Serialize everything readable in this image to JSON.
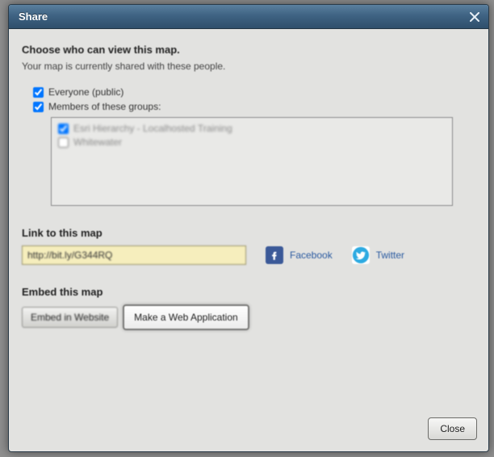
{
  "dialog": {
    "title": "Share",
    "heading": "Choose who can view this map.",
    "subtext": "Your map is currently shared with these people.",
    "everyone_label": "Everyone (public)",
    "everyone_checked": true,
    "members_label": "Members of these groups:",
    "members_checked": true,
    "groups": [
      {
        "label": "Esri Hierarchy - Localhosted Training",
        "checked": true
      },
      {
        "label": "Whitewater",
        "checked": false
      }
    ],
    "link_section_label": "Link to this map",
    "link_value": "http://bit.ly/G344RQ",
    "facebook_label": "Facebook",
    "twitter_label": "Twitter",
    "embed_section_label": "Embed this map",
    "embed_btn": "Embed in Website",
    "webapp_btn": "Make a Web Application",
    "close_btn": "Close"
  }
}
